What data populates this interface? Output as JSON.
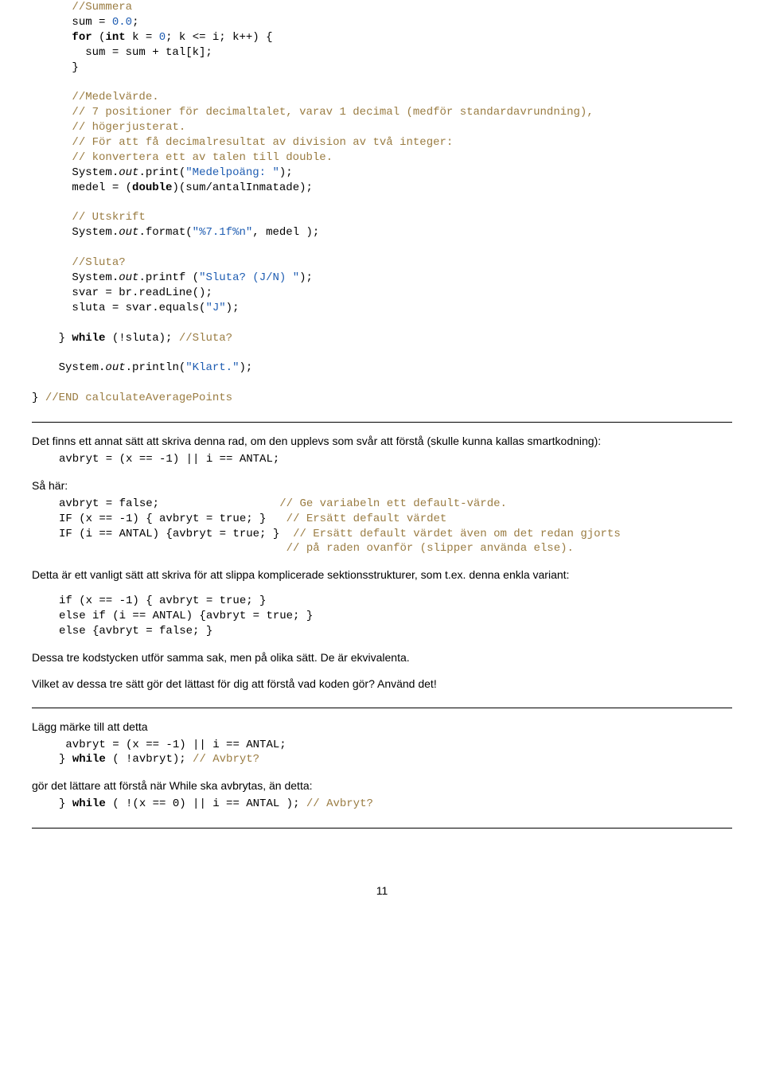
{
  "code1": {
    "l01": "//Summera",
    "l02a": "sum = ",
    "l02b": "0.0",
    "l02c": ";",
    "l03a": "for",
    "l03b": " (",
    "l03c": "int",
    "l03d": " k = ",
    "l03e": "0",
    "l03f": "; k <= i; k++) {",
    "l04": "        sum = sum + tal[k];",
    "l05": "}",
    "l06": "//Medelvärde.",
    "l07": "// 7 positioner för decimaltalet, varav 1 decimal (medför standardavrundning),",
    "l08": "// högerjusterat.",
    "l09": "// För att få decimalresultat av division av två integer:",
    "l10": "// konvertera ett av talen till double.",
    "l11a": "System.",
    "l11b": "out",
    "l11c": ".print(",
    "l11d": "\"Medelpoäng: \"",
    "l11e": ");",
    "l12a": "medel = (",
    "l12b": "double",
    "l12c": ")(sum/antalInmatade);",
    "l13": "// Utskrift",
    "l14a": "System.",
    "l14b": "out",
    "l14c": ".format(",
    "l14d": "\"%7.1f%n\"",
    "l14e": ", medel );",
    "l15": "//Sluta?",
    "l16a": "System.",
    "l16b": "out",
    "l16c": ".printf (",
    "l16d": "\"Sluta? (J/N) \"",
    "l16e": ");",
    "l17": "svar = br.readLine();",
    "l18a": "sluta = svar.equals(",
    "l18b": "\"J\"",
    "l18c": ");",
    "l19a": "} ",
    "l19b": "while",
    "l19c": " (!sluta); ",
    "l19d": "//Sluta?",
    "l20a": "System.",
    "l20b": "out",
    "l20c": ".println(",
    "l20d": "\"Klart.\"",
    "l20e": ");",
    "l21a": "} ",
    "l21b": "//END calculateAveragePoints"
  },
  "section2": {
    "p1": "Det finns ett annat sätt att skriva denna rad, om den upplevs som svår att förstå (skulle kunna kallas smartkodning):",
    "c1": "avbryt = (x == -1) || i == ANTAL;",
    "p2": "Så här:",
    "c2a": "avbryt = false;",
    "c2a_cm": "// Ge variabeln ett default-värde.",
    "c2b": "IF (x == -1) { avbryt = true; }",
    "c2b_cm": "// Ersätt default värdet",
    "c2c": "IF (i == ANTAL) {avbryt = true; }",
    "c2c_cm": "// Ersätt default värdet även om det redan gjorts",
    "c2d_cm": "// på raden ovanför (slipper använda else).",
    "p3": "Detta är ett vanligt sätt att skriva för att slippa komplicerade sektionsstrukturer, som t.ex. denna enkla variant:",
    "c3a": "if (x == -1) { avbryt = true; }",
    "c3b": "else if (i == ANTAL) {avbryt = true; }",
    "c3c": "else {avbryt = false; }",
    "p4": "Dessa tre kodstycken utför samma sak, men på olika sätt. De är ekvivalenta.",
    "p5": "Vilket av dessa tre sätt gör det lättast för dig att förstå vad koden gör? Använd det!"
  },
  "section3": {
    "p1": "Lägg märke till att detta",
    "c1a": "avbryt = (x == -1) || i == ANTAL;",
    "c1b_a": "} ",
    "c1b_b": "while",
    "c1b_c": " ( !avbryt); ",
    "c1b_d": "// Avbryt?",
    "p2": "gör det lättare att förstå när While ska avbrytas, än detta:",
    "c2a": "} ",
    "c2b": "while",
    "c2c": " ( !(x == 0) || i == ANTAL ); ",
    "c2d": "// Avbryt?"
  },
  "pagenum": "11"
}
